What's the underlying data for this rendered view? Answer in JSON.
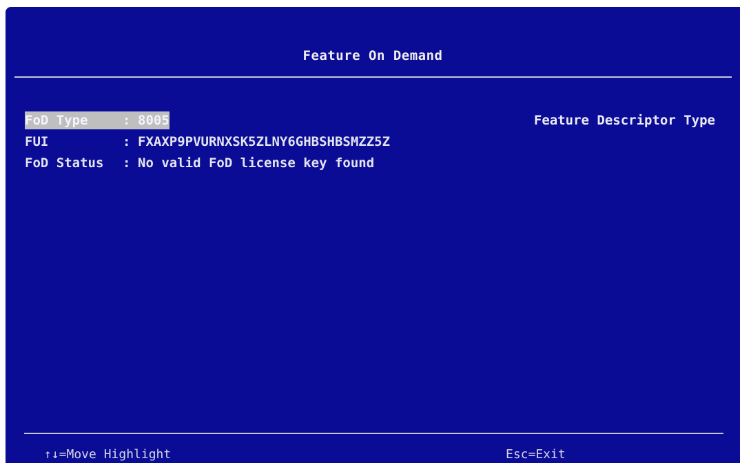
{
  "header": {
    "title": "Feature On Demand"
  },
  "fields": [
    {
      "label": "FoD Type",
      "separator": ":",
      "value": "8005"
    },
    {
      "label": "FUI",
      "separator": ":",
      "value": "FXAXP9PVURNXSK5ZLNY6GHBSHBSMZZ5Z"
    },
    {
      "label": "FoD Status",
      "separator": ":",
      "value": "No valid FoD license key found"
    }
  ],
  "help_panel": {
    "text": "Feature Descriptor Type"
  },
  "footer": {
    "move_hint": "↑↓=Move Highlight",
    "exit_hint": "Esc=Exit"
  },
  "colors": {
    "background": "#0b0c96",
    "highlight": "#bfbfbf",
    "text": "#e6e6ee"
  }
}
